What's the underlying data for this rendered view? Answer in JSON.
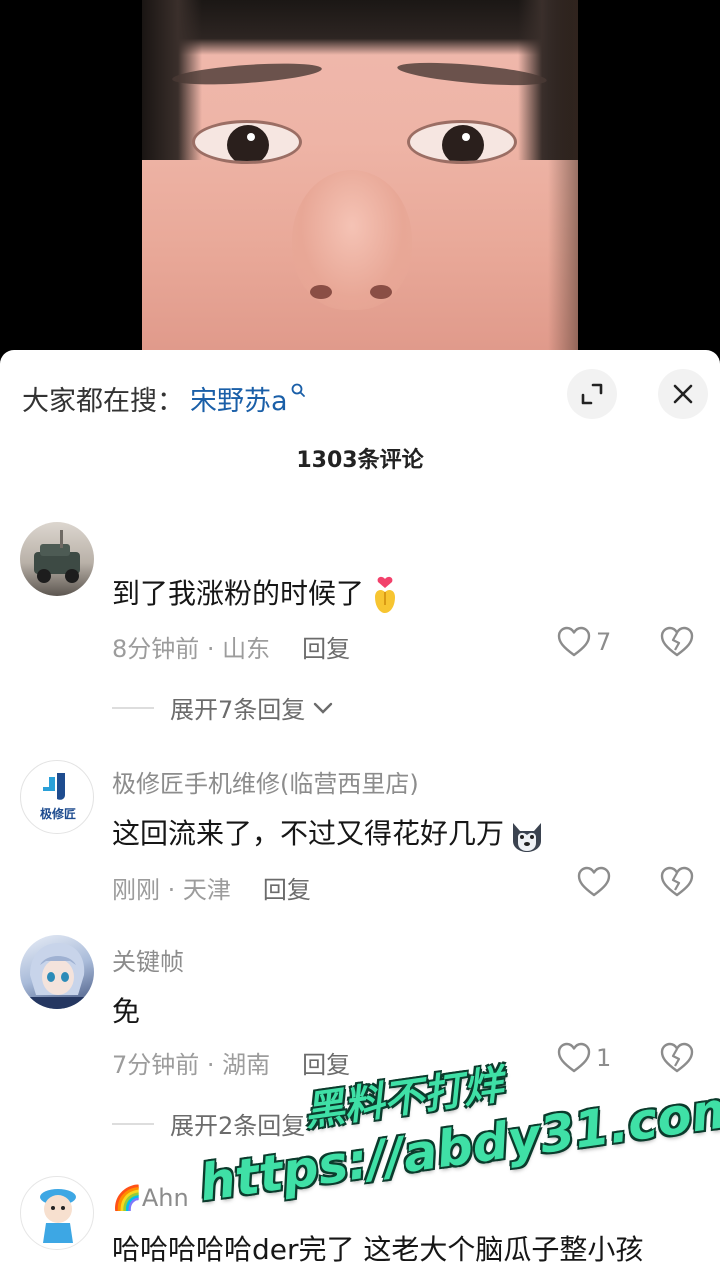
{
  "search": {
    "prefix": "大家都在搜：",
    "term": "宋野苏a"
  },
  "header": {
    "comment_count": "1303条评论"
  },
  "comments": [
    {
      "username": "",
      "text": "到了我涨粉的时候了",
      "emoji": "heart-hands-emoji",
      "time_location": "8分钟前 · 山东",
      "reply_label": "回复",
      "likes": "7",
      "expand_label": "展开7条回复"
    },
    {
      "username": "极修匠手机维修(临营西里店)",
      "text": "这回流来了，不过又得花好几万",
      "emoji": "husky-emoji",
      "time_location": "刚刚 · 天津",
      "reply_label": "回复",
      "likes": ""
    },
    {
      "username": "关键帧",
      "text": "免",
      "time_location": "7分钟前 · 湖南",
      "reply_label": "回复",
      "likes": "1",
      "expand_label": "展开2条回复"
    },
    {
      "username": "🌈Ahn",
      "text": "哈哈哈哈哈der完了 这老大个脑瓜子整小孩"
    }
  ],
  "avatars": {
    "c2_logo_text": "极修匠"
  },
  "watermark": {
    "line1": "黑料不打烊",
    "line2": "https://abdy31.com"
  },
  "colors": {
    "search_term": "#1a5fa8",
    "watermark": "#3fe0a6"
  },
  "icons": [
    "search-mini-icon",
    "expand-icon",
    "close-icon",
    "heart-icon",
    "broken-heart-icon",
    "chevron-down-icon"
  ]
}
